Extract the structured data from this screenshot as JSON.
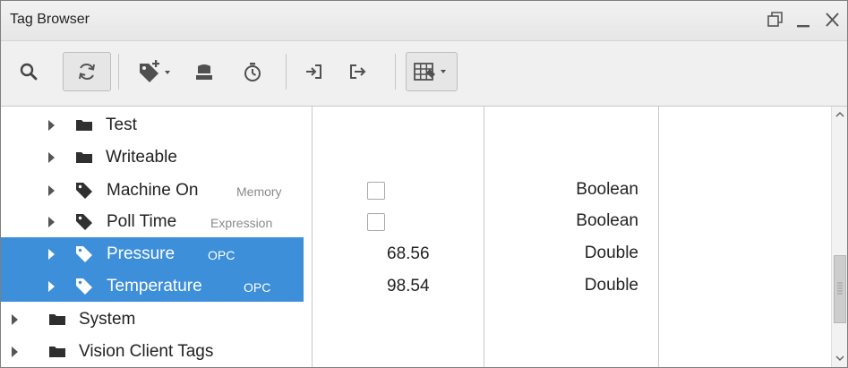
{
  "window": {
    "title": "Tag Browser"
  },
  "toolbar": {
    "buttons": [
      {
        "icon": "search-icon"
      },
      {
        "icon": "refresh-icon",
        "pressed": true
      },
      {
        "icon": "add-tag-icon",
        "dropdown": true
      },
      {
        "icon": "database-icon"
      },
      {
        "icon": "timer-icon"
      },
      {
        "icon": "import-icon"
      },
      {
        "icon": "export-icon"
      },
      {
        "icon": "table-view-icon",
        "dropdown": true
      }
    ]
  },
  "tree": {
    "rows": [
      {
        "label": "Test",
        "icon": "folder-icon",
        "type": "",
        "value": "",
        "checkbox": false,
        "datatype": "",
        "selected": false
      },
      {
        "label": "Writeable",
        "icon": "folder-icon",
        "type": "",
        "value": "",
        "checkbox": false,
        "datatype": "",
        "selected": false
      },
      {
        "label": "Machine On",
        "icon": "tag-icon",
        "type": "Memory",
        "value": "",
        "checkbox": true,
        "datatype": "Boolean",
        "selected": false
      },
      {
        "label": "Poll Time",
        "icon": "tag-icon",
        "type": "Expression",
        "value": "",
        "checkbox": true,
        "datatype": "Boolean",
        "selected": false
      },
      {
        "label": "Pressure",
        "icon": "tag-icon",
        "type": "OPC",
        "value": "68.56",
        "checkbox": false,
        "datatype": "Double",
        "selected": true
      },
      {
        "label": "Temperature",
        "icon": "tag-icon",
        "type": "OPC",
        "value": "98.54",
        "checkbox": false,
        "datatype": "Double",
        "selected": true
      },
      {
        "label": "System",
        "icon": "folder-icon",
        "type": "",
        "value": "",
        "checkbox": false,
        "datatype": "",
        "selected": false
      },
      {
        "label": "Vision Client Tags",
        "icon": "folder-icon",
        "type": "",
        "value": "",
        "checkbox": false,
        "datatype": "",
        "selected": false
      }
    ]
  },
  "colors": {
    "selection": "#3d8fd9",
    "icon_gray": "#555555"
  }
}
